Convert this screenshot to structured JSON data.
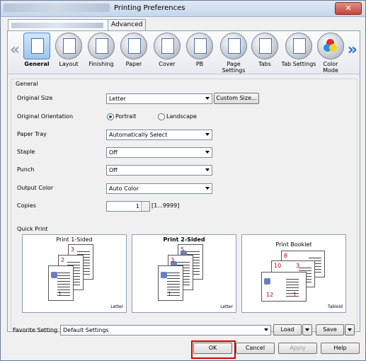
{
  "window": {
    "title": "Printing Preferences",
    "close_glyph": "✕"
  },
  "tabs": {
    "advanced": "Advanced"
  },
  "nav": {
    "left_arrow": "«",
    "right_arrow": "»",
    "items": [
      {
        "label": "General",
        "icon": "general-icon"
      },
      {
        "label": "Layout",
        "icon": "layout-icon"
      },
      {
        "label": "Finishing",
        "icon": "finishing-icon"
      },
      {
        "label": "Paper",
        "icon": "paper-icon"
      },
      {
        "label": "Cover",
        "icon": "cover-icon"
      },
      {
        "label": "PB",
        "icon": "pb-icon"
      },
      {
        "label": "Page Settings",
        "icon": "page-settings-icon"
      },
      {
        "label": "Tabs",
        "icon": "tabs-icon"
      },
      {
        "label": "Tab Settings",
        "icon": "tab-settings-icon"
      },
      {
        "label": "Color Mode",
        "icon": "color-mode-icon"
      }
    ]
  },
  "general": {
    "group_title": "General",
    "original_size": {
      "label": "Original Size",
      "value": "Letter",
      "custom_button": "Custom Size..."
    },
    "orientation": {
      "label": "Original Orientation",
      "portrait": "Portrait",
      "landscape": "Landscape",
      "selected": "Portrait"
    },
    "paper_tray": {
      "label": "Paper Tray",
      "value": "Automatically Select"
    },
    "staple": {
      "label": "Staple",
      "value": "Off"
    },
    "punch": {
      "label": "Punch",
      "value": "Off"
    },
    "output_color": {
      "label": "Output Color",
      "value": "Auto Color"
    },
    "copies": {
      "label": "Copies",
      "value": "1",
      "range": "[1...9999]"
    }
  },
  "quick_print": {
    "title": "Quick Print",
    "items": [
      {
        "title": "Print 1-Sided",
        "paper": "Letter",
        "pages": [
          "3",
          "2",
          "1"
        ]
      },
      {
        "title": "Print 2-Sided",
        "paper": "Letter",
        "pages": [
          "5",
          "3",
          "1"
        ]
      },
      {
        "title": "Print Booklet",
        "paper": "Tabloid",
        "pages": [
          "8",
          "10",
          "3",
          "12",
          "1"
        ]
      }
    ]
  },
  "favorite": {
    "label": "Favorite Setting",
    "value": "Default Settings",
    "load": "Load",
    "save": "Save"
  },
  "buttons": {
    "ok": "OK",
    "cancel": "Cancel",
    "apply": "Apply",
    "help": "Help"
  },
  "colors": {
    "highlight": "#d60000",
    "page_number": "#c00000",
    "accent": "#2a6ad1"
  }
}
